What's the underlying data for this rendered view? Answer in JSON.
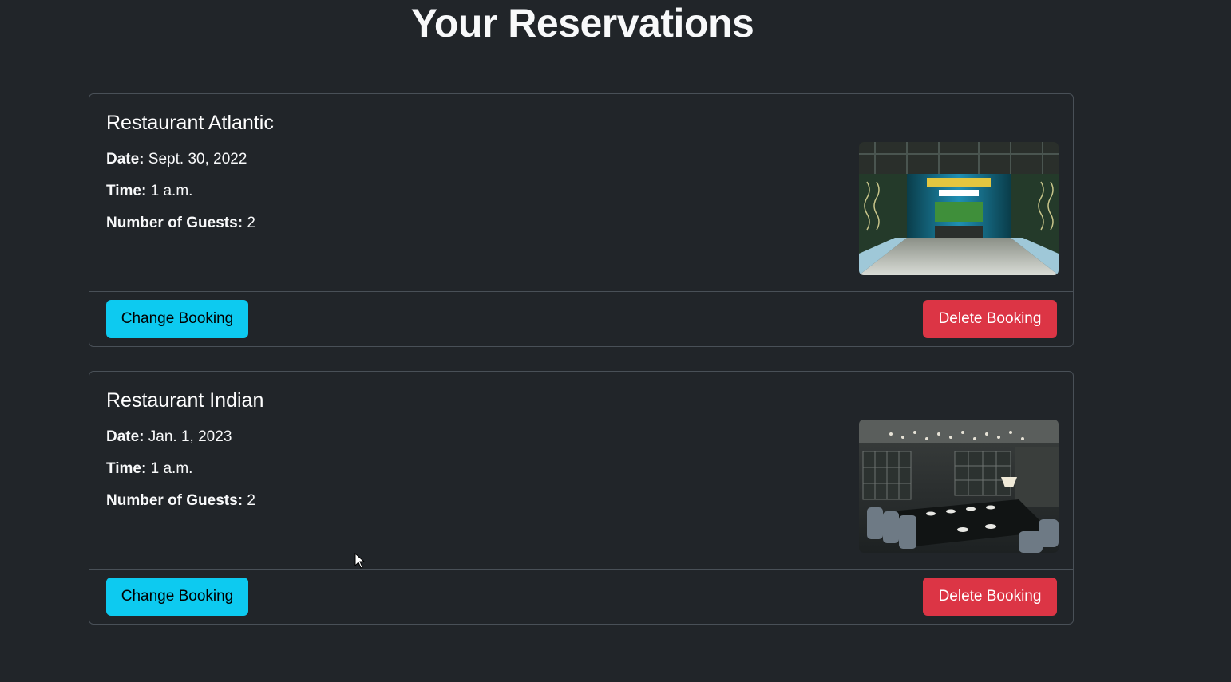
{
  "page": {
    "title": "Your Reservations"
  },
  "labels": {
    "date": "Date:",
    "time": "Time:",
    "guests": "Number of Guests:"
  },
  "reservations": [
    {
      "restaurant": "Restaurant Atlantic",
      "date": "Sept. 30, 2022",
      "time": "1 a.m.",
      "guests": "2",
      "image": "restaurant-interior-photo",
      "change_label": "Change Booking",
      "delete_label": "Delete Booking"
    },
    {
      "restaurant": "Restaurant Indian",
      "date": "Jan. 1, 2023",
      "time": "1 a.m.",
      "guests": "2",
      "image": "restaurant-interior-photo",
      "change_label": "Change Booking",
      "delete_label": "Delete Booking"
    }
  ],
  "colors": {
    "background": "#212529",
    "change_button": "#0dcaf0",
    "delete_button": "#dc3545",
    "border": "#495057"
  }
}
